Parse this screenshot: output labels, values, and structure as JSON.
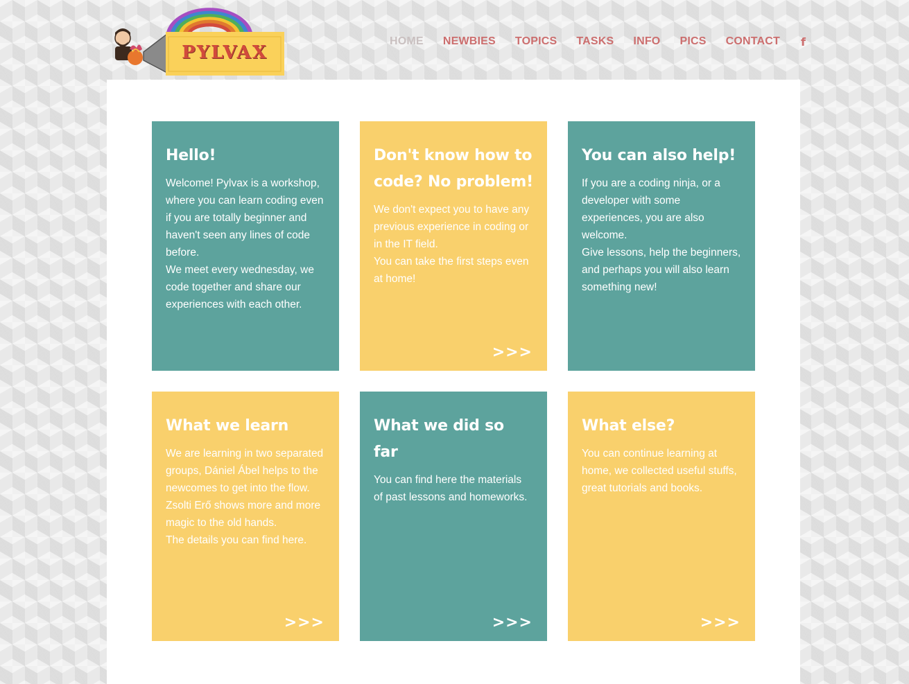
{
  "header": {
    "logo_text": "PYLVAX",
    "nav": [
      {
        "label": "HOME",
        "active": true
      },
      {
        "label": "NEWBIES",
        "active": false
      },
      {
        "label": "TOPICS",
        "active": false
      },
      {
        "label": "TASKS",
        "active": false
      },
      {
        "label": "INFO",
        "active": false
      },
      {
        "label": "PICS",
        "active": false
      },
      {
        "label": "CONTACT",
        "active": false
      }
    ],
    "facebook_glyph": "f",
    "facebook_icon": "facebook-icon"
  },
  "colors": {
    "teal": "#5da39d",
    "yellow": "#f9d06c",
    "nav_link": "#cc6e6e",
    "nav_active": "#c9c0c0"
  },
  "cards": [
    {
      "color": "teal",
      "title": "Hello!",
      "body": [
        "Welcome! Pylvax is a workshop, where you can learn coding even if you are totally beginner and haven't seen any lines of code before.",
        "We meet every wednesday, we code together and share our experiences with each other."
      ],
      "more": ""
    },
    {
      "color": "yellow",
      "title": "Don't know how to code? No problem!",
      "body": [
        "We don't expect you to have any previous experience in coding or in the IT field.",
        "You can take the first steps even at home!"
      ],
      "more": ">>>"
    },
    {
      "color": "teal",
      "title": "You can also help!",
      "body": [
        "If you are a coding ninja, or a developer with some experiences, you are also welcome.",
        "Give lessons, help the beginners, and perhaps you will also learn something new!"
      ],
      "more": ""
    },
    {
      "color": "yellow",
      "title": "What we learn",
      "body": [
        "We are learning in two separated groups, Dániel Ábel helps to the newcomes to get into the flow.",
        "Zsolti Erő shows more and more magic to the old hands.",
        "The details you can find here."
      ],
      "more": ">>>"
    },
    {
      "color": "teal",
      "title": "What we did so far",
      "body": [
        "You can find here the materials of past lessons and homeworks."
      ],
      "more": ">>>"
    },
    {
      "color": "yellow",
      "title": "What else?",
      "body": [
        "You can continue learning at home, we collected useful stuffs, great tutorials and books."
      ],
      "more": ">>>"
    }
  ]
}
